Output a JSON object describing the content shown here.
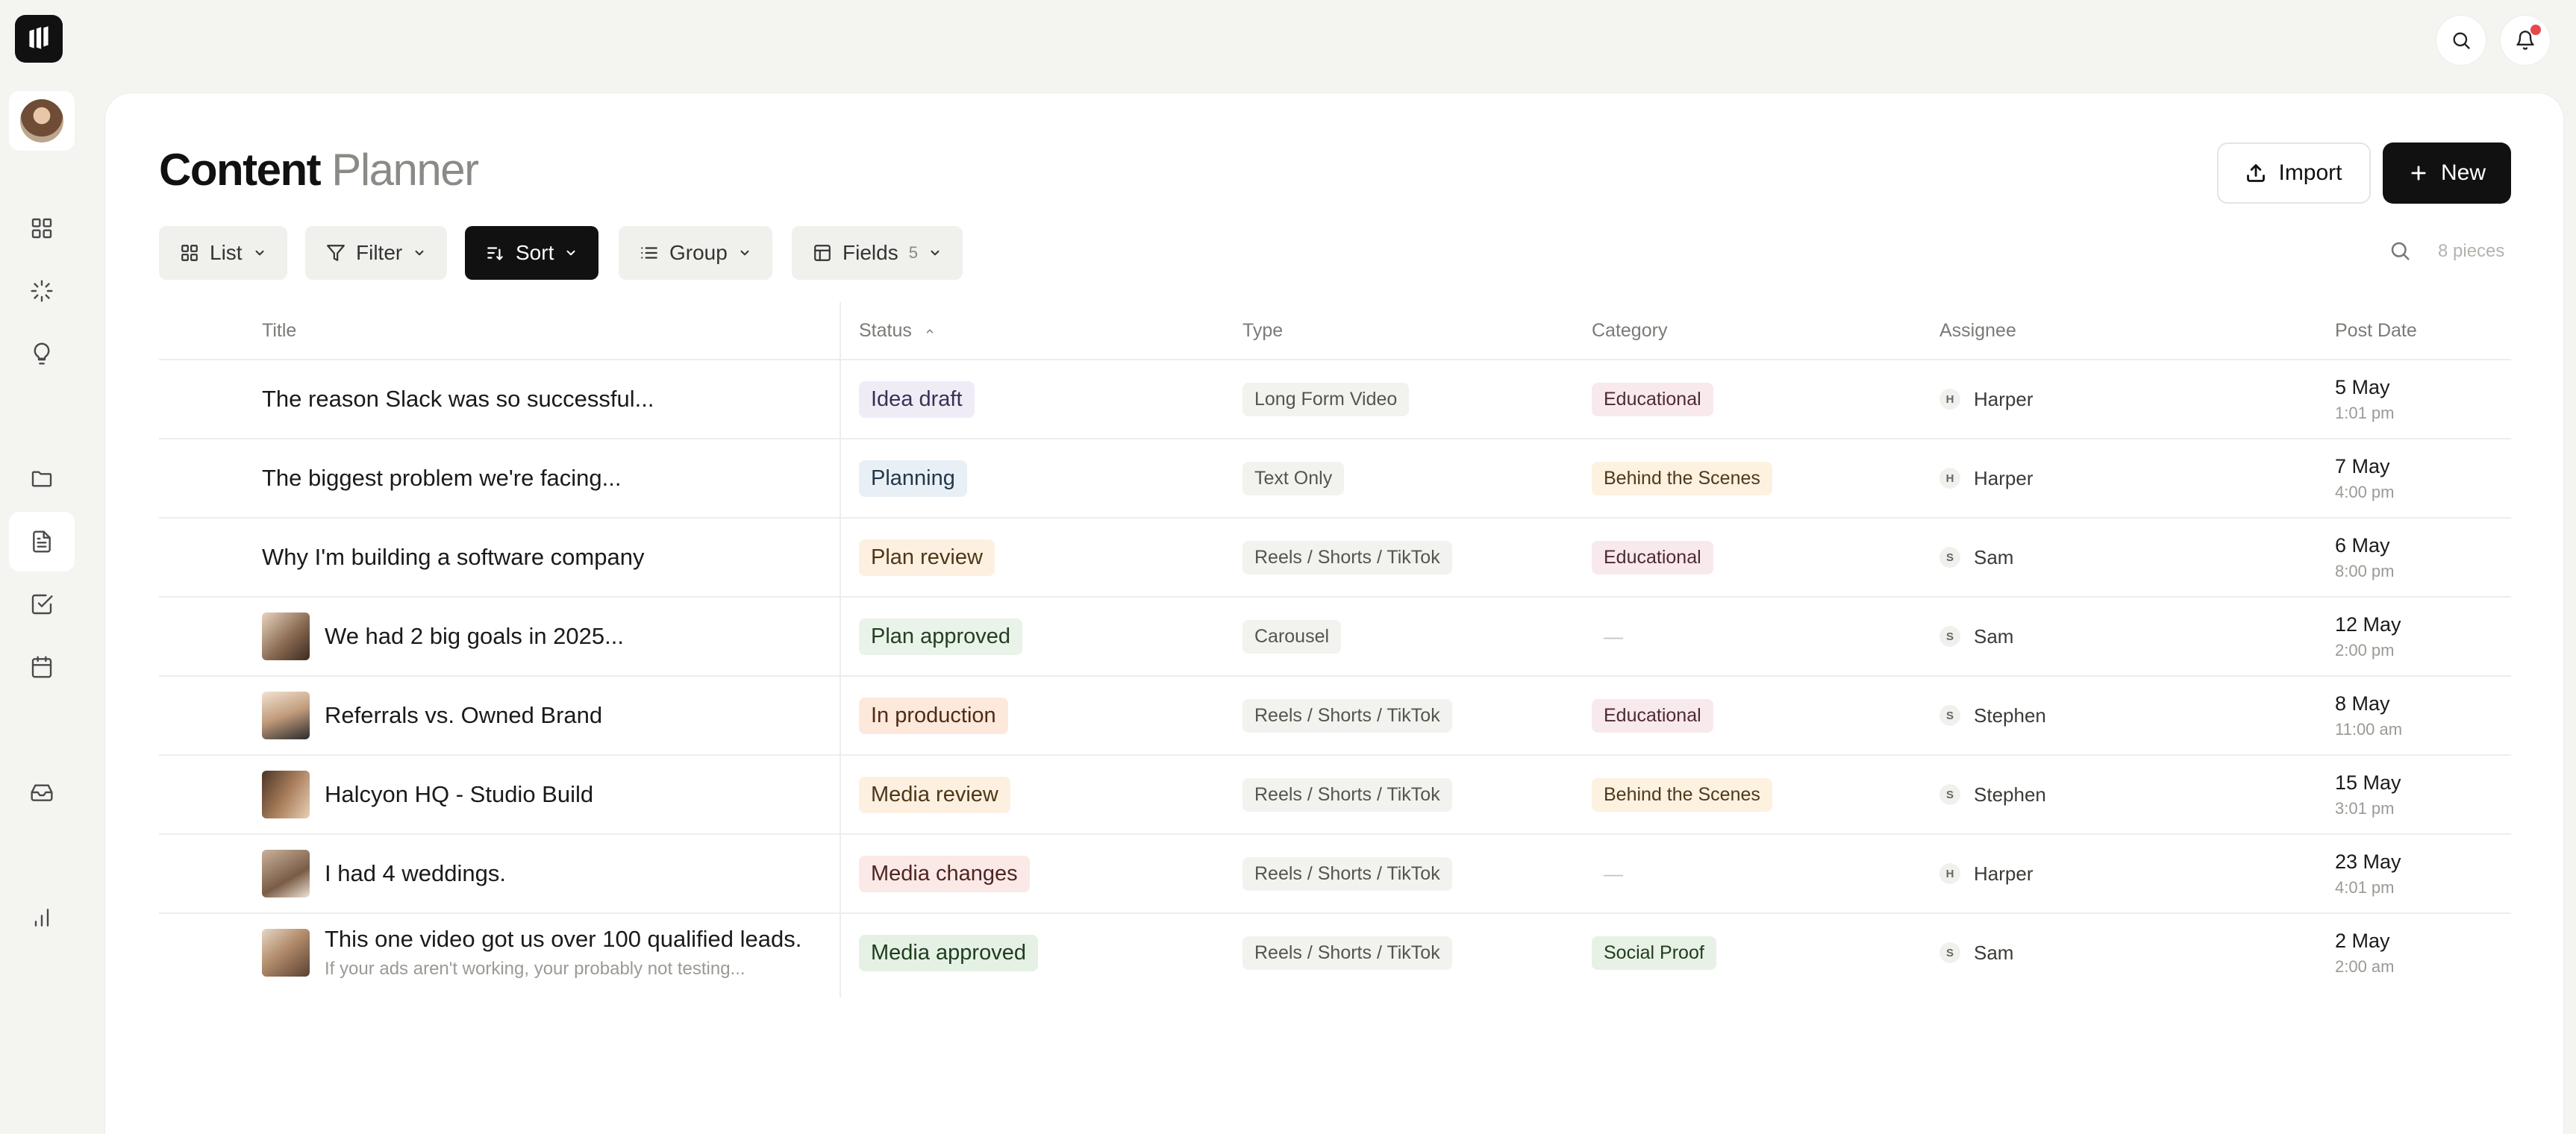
{
  "app": {
    "title_bold": "Content",
    "title_light": "Planner"
  },
  "sidebar": {
    "items": [
      {
        "name": "grid-icon"
      },
      {
        "name": "loader-icon"
      },
      {
        "name": "lightbulb-icon"
      },
      {
        "name": "folder-icon"
      },
      {
        "name": "document-icon",
        "active": true
      },
      {
        "name": "checkbox-icon"
      },
      {
        "name": "calendar-icon"
      },
      {
        "name": "inbox-icon"
      },
      {
        "name": "bar-chart-icon"
      }
    ]
  },
  "header": {
    "import_label": "Import",
    "new_label": "New"
  },
  "toolbar": {
    "list_label": "List",
    "filter_label": "Filter",
    "sort_label": "Sort",
    "group_label": "Group",
    "fields_label": "Fields",
    "fields_count": "5",
    "pieces_label": "8 pieces"
  },
  "table": {
    "columns": {
      "title": "Title",
      "status": "Status",
      "type": "Type",
      "category": "Category",
      "assignee": "Assignee",
      "post_date": "Post Date"
    },
    "rows": [
      {
        "title": "The reason Slack was so successful...",
        "status": "Idea draft",
        "type": "Long Form Video",
        "category": "Educational",
        "initial": "H",
        "assignee": "Harper",
        "date": "5 May",
        "time": "1:01 pm"
      },
      {
        "title": "The biggest problem we're facing...",
        "status": "Planning",
        "type": "Text Only",
        "category": "Behind the Scenes",
        "initial": "H",
        "assignee": "Harper",
        "date": "7 May",
        "time": "4:00 pm"
      },
      {
        "title": "Why I'm building a software company",
        "status": "Plan review",
        "type": "Reels / Shorts / TikTok",
        "category": "Educational",
        "initial": "S",
        "assignee": "Sam",
        "date": "6 May",
        "time": "8:00 pm"
      },
      {
        "title": "We had 2 big goals in 2025...",
        "status": "Plan approved",
        "type": "Carousel",
        "category": "—",
        "initial": "S",
        "assignee": "Sam",
        "date": "12 May",
        "time": "2:00 pm"
      },
      {
        "title": "Referrals vs. Owned Brand",
        "status": "In production",
        "type": "Reels / Shorts / TikTok",
        "category": "Educational",
        "initial": "S",
        "assignee": "Stephen",
        "date": "8 May",
        "time": "11:00 am"
      },
      {
        "title": "Halcyon HQ - Studio Build",
        "status": "Media review",
        "type": "Reels / Shorts / TikTok",
        "category": "Behind the Scenes",
        "initial": "S",
        "assignee": "Stephen",
        "date": "15 May",
        "time": "3:01 pm"
      },
      {
        "title": "I had 4 weddings.",
        "status": "Media changes",
        "type": "Reels / Shorts / TikTok",
        "category": "—",
        "initial": "H",
        "assignee": "Harper",
        "date": "23 May",
        "time": "4:01 pm"
      },
      {
        "title": "This one video got us over 100 qualified leads.",
        "subtitle": "If your ads aren't working, your probably not testing...",
        "status": "Media approved",
        "type": "Reels / Shorts / TikTok",
        "category": "Social Proof",
        "initial": "S",
        "assignee": "Sam",
        "date": "2 May",
        "time": "2:00 am"
      }
    ]
  },
  "colors": {
    "idea_draft": "#f0ecf6",
    "planning": "#e8f0f6",
    "plan_review": "#fdf0e0",
    "plan_approved": "#eaf3ea",
    "in_production": "#fde9dc",
    "media_review": "#fdf0e0",
    "media_changes": "#fbe9e7",
    "media_approved": "#e5f1e4",
    "educational": "#f8e9ec",
    "behind_the_scenes": "#fdf1e0",
    "social_proof": "#e7f1e5"
  }
}
